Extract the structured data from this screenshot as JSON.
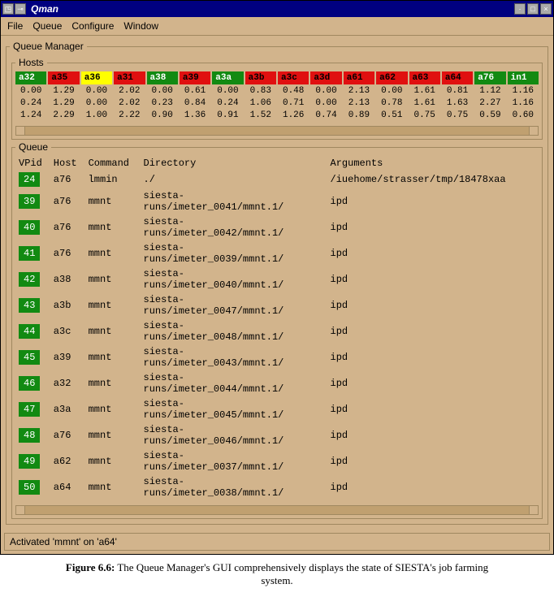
{
  "window": {
    "title": "Qman",
    "menubar": [
      "File",
      "Queue",
      "Configure",
      "Window"
    ]
  },
  "queueManager": {
    "label": "Queue Manager"
  },
  "hosts": {
    "label": "Hosts",
    "columns": [
      {
        "name": "a32",
        "status": "green"
      },
      {
        "name": "a35",
        "status": "red"
      },
      {
        "name": "a36",
        "status": "yellow"
      },
      {
        "name": "a31",
        "status": "red"
      },
      {
        "name": "a38",
        "status": "green"
      },
      {
        "name": "a39",
        "status": "red"
      },
      {
        "name": "a3a",
        "status": "green"
      },
      {
        "name": "a3b",
        "status": "red"
      },
      {
        "name": "a3c",
        "status": "red"
      },
      {
        "name": "a3d",
        "status": "red"
      },
      {
        "name": "a61",
        "status": "red"
      },
      {
        "name": "a62",
        "status": "red"
      },
      {
        "name": "a63",
        "status": "red"
      },
      {
        "name": "a64",
        "status": "red"
      },
      {
        "name": "a76",
        "status": "green"
      },
      {
        "name": "in1",
        "status": "green"
      }
    ],
    "rows": [
      [
        "0.00",
        "1.29",
        "0.00",
        "2.02",
        "0.00",
        "0.61",
        "0.00",
        "0.83",
        "0.48",
        "0.00",
        "2.13",
        "0.00",
        "1.61",
        "0.81",
        "1.12",
        "1.16"
      ],
      [
        "0.24",
        "1.29",
        "0.00",
        "2.02",
        "0.23",
        "0.84",
        "0.24",
        "1.06",
        "0.71",
        "0.00",
        "2.13",
        "0.78",
        "1.61",
        "1.63",
        "2.27",
        "1.16"
      ],
      [
        "1.24",
        "2.29",
        "1.00",
        "2.22",
        "0.90",
        "1.36",
        "0.91",
        "1.52",
        "1.26",
        "0.74",
        "0.89",
        "0.51",
        "0.75",
        "0.75",
        "0.59",
        "0.60"
      ]
    ]
  },
  "queue": {
    "label": "Queue",
    "headers": {
      "vpid": "VPid",
      "host": "Host",
      "command": "Command",
      "directory": "Directory",
      "arguments": "Arguments"
    },
    "rows": [
      {
        "vpid": "24",
        "host": "a76",
        "command": "lmmin",
        "directory": "./",
        "arguments": "/iuehome/strasser/tmp/18478xaa"
      },
      {
        "vpid": "39",
        "host": "a76",
        "command": "mmnt",
        "directory": "siesta-runs/imeter_0041/mmnt.1/",
        "arguments": "ipd"
      },
      {
        "vpid": "40",
        "host": "a76",
        "command": "mmnt",
        "directory": "siesta-runs/imeter_0042/mmnt.1/",
        "arguments": "ipd"
      },
      {
        "vpid": "41",
        "host": "a76",
        "command": "mmnt",
        "directory": "siesta-runs/imeter_0039/mmnt.1/",
        "arguments": "ipd"
      },
      {
        "vpid": "42",
        "host": "a38",
        "command": "mmnt",
        "directory": "siesta-runs/imeter_0040/mmnt.1/",
        "arguments": "ipd"
      },
      {
        "vpid": "43",
        "host": "a3b",
        "command": "mmnt",
        "directory": "siesta-runs/imeter_0047/mmnt.1/",
        "arguments": "ipd"
      },
      {
        "vpid": "44",
        "host": "a3c",
        "command": "mmnt",
        "directory": "siesta-runs/imeter_0048/mmnt.1/",
        "arguments": "ipd"
      },
      {
        "vpid": "45",
        "host": "a39",
        "command": "mmnt",
        "directory": "siesta-runs/imeter_0043/mmnt.1/",
        "arguments": "ipd"
      },
      {
        "vpid": "46",
        "host": "a32",
        "command": "mmnt",
        "directory": "siesta-runs/imeter_0044/mmnt.1/",
        "arguments": "ipd"
      },
      {
        "vpid": "47",
        "host": "a3a",
        "command": "mmnt",
        "directory": "siesta-runs/imeter_0045/mmnt.1/",
        "arguments": "ipd"
      },
      {
        "vpid": "48",
        "host": "a76",
        "command": "mmnt",
        "directory": "siesta-runs/imeter_0046/mmnt.1/",
        "arguments": "ipd"
      },
      {
        "vpid": "49",
        "host": "a62",
        "command": "mmnt",
        "directory": "siesta-runs/imeter_0037/mmnt.1/",
        "arguments": "ipd"
      },
      {
        "vpid": "50",
        "host": "a64",
        "command": "mmnt",
        "directory": "siesta-runs/imeter_0038/mmnt.1/",
        "arguments": "ipd"
      }
    ]
  },
  "statusbar": "Activated 'mmnt' on 'a64'",
  "caption": {
    "fignum": "Figure 6.6:",
    "text": "The Queue Manager's GUI comprehensively displays the state of SIESTA's job farming system."
  }
}
